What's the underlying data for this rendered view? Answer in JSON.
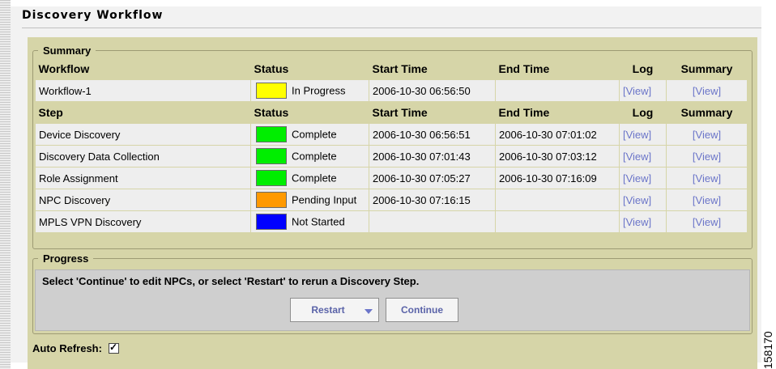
{
  "window": {
    "title": "Discovery Workflow"
  },
  "summary": {
    "legend": "Summary",
    "workflow_headers": [
      "Workflow",
      "Status",
      "Start Time",
      "End Time",
      "Log",
      "Summary"
    ],
    "workflow_row": {
      "name": "Workflow-1",
      "status": "In Progress",
      "status_color": "#ffff00",
      "start": "2006-10-30 06:56:50",
      "end": "",
      "log": "[View]",
      "summary": "[View]"
    },
    "step_headers": [
      "Step",
      "Status",
      "Start Time",
      "End Time",
      "Log",
      "Summary"
    ],
    "steps": [
      {
        "name": "Device Discovery",
        "status": "Complete",
        "status_color": "#00ee00",
        "start": "2006-10-30 06:56:51",
        "end": "2006-10-30 07:01:02",
        "log": "[View]",
        "summary": "[View]"
      },
      {
        "name": "Discovery Data Collection",
        "status": "Complete",
        "status_color": "#00ee00",
        "start": "2006-10-30 07:01:43",
        "end": "2006-10-30 07:03:12",
        "log": "[View]",
        "summary": "[View]"
      },
      {
        "name": "Role Assignment",
        "status": "Complete",
        "status_color": "#00ee00",
        "start": "2006-10-30 07:05:27",
        "end": "2006-10-30 07:16:09",
        "log": "[View]",
        "summary": "[View]"
      },
      {
        "name": "NPC Discovery",
        "status": "Pending Input",
        "status_color": "#ff9900",
        "start": "2006-10-30 07:16:15",
        "end": "",
        "log": "[View]",
        "summary": "[View]"
      },
      {
        "name": "MPLS VPN Discovery",
        "status": "Not Started",
        "status_color": "#0000ff",
        "start": "",
        "end": "",
        "log": "[View]",
        "summary": "[View]"
      }
    ]
  },
  "progress": {
    "legend": "Progress",
    "message": "Select 'Continue' to edit NPCs, or select 'Restart' to rerun a Discovery Step.",
    "restart_label": "Restart",
    "continue_label": "Continue"
  },
  "auto_refresh": {
    "label": "Auto Refresh:",
    "checked": true,
    "check_glyph": "✓"
  },
  "figure_id": "158170",
  "colors": {
    "panel": "#d6d5a8",
    "link": "#6b75c9"
  }
}
